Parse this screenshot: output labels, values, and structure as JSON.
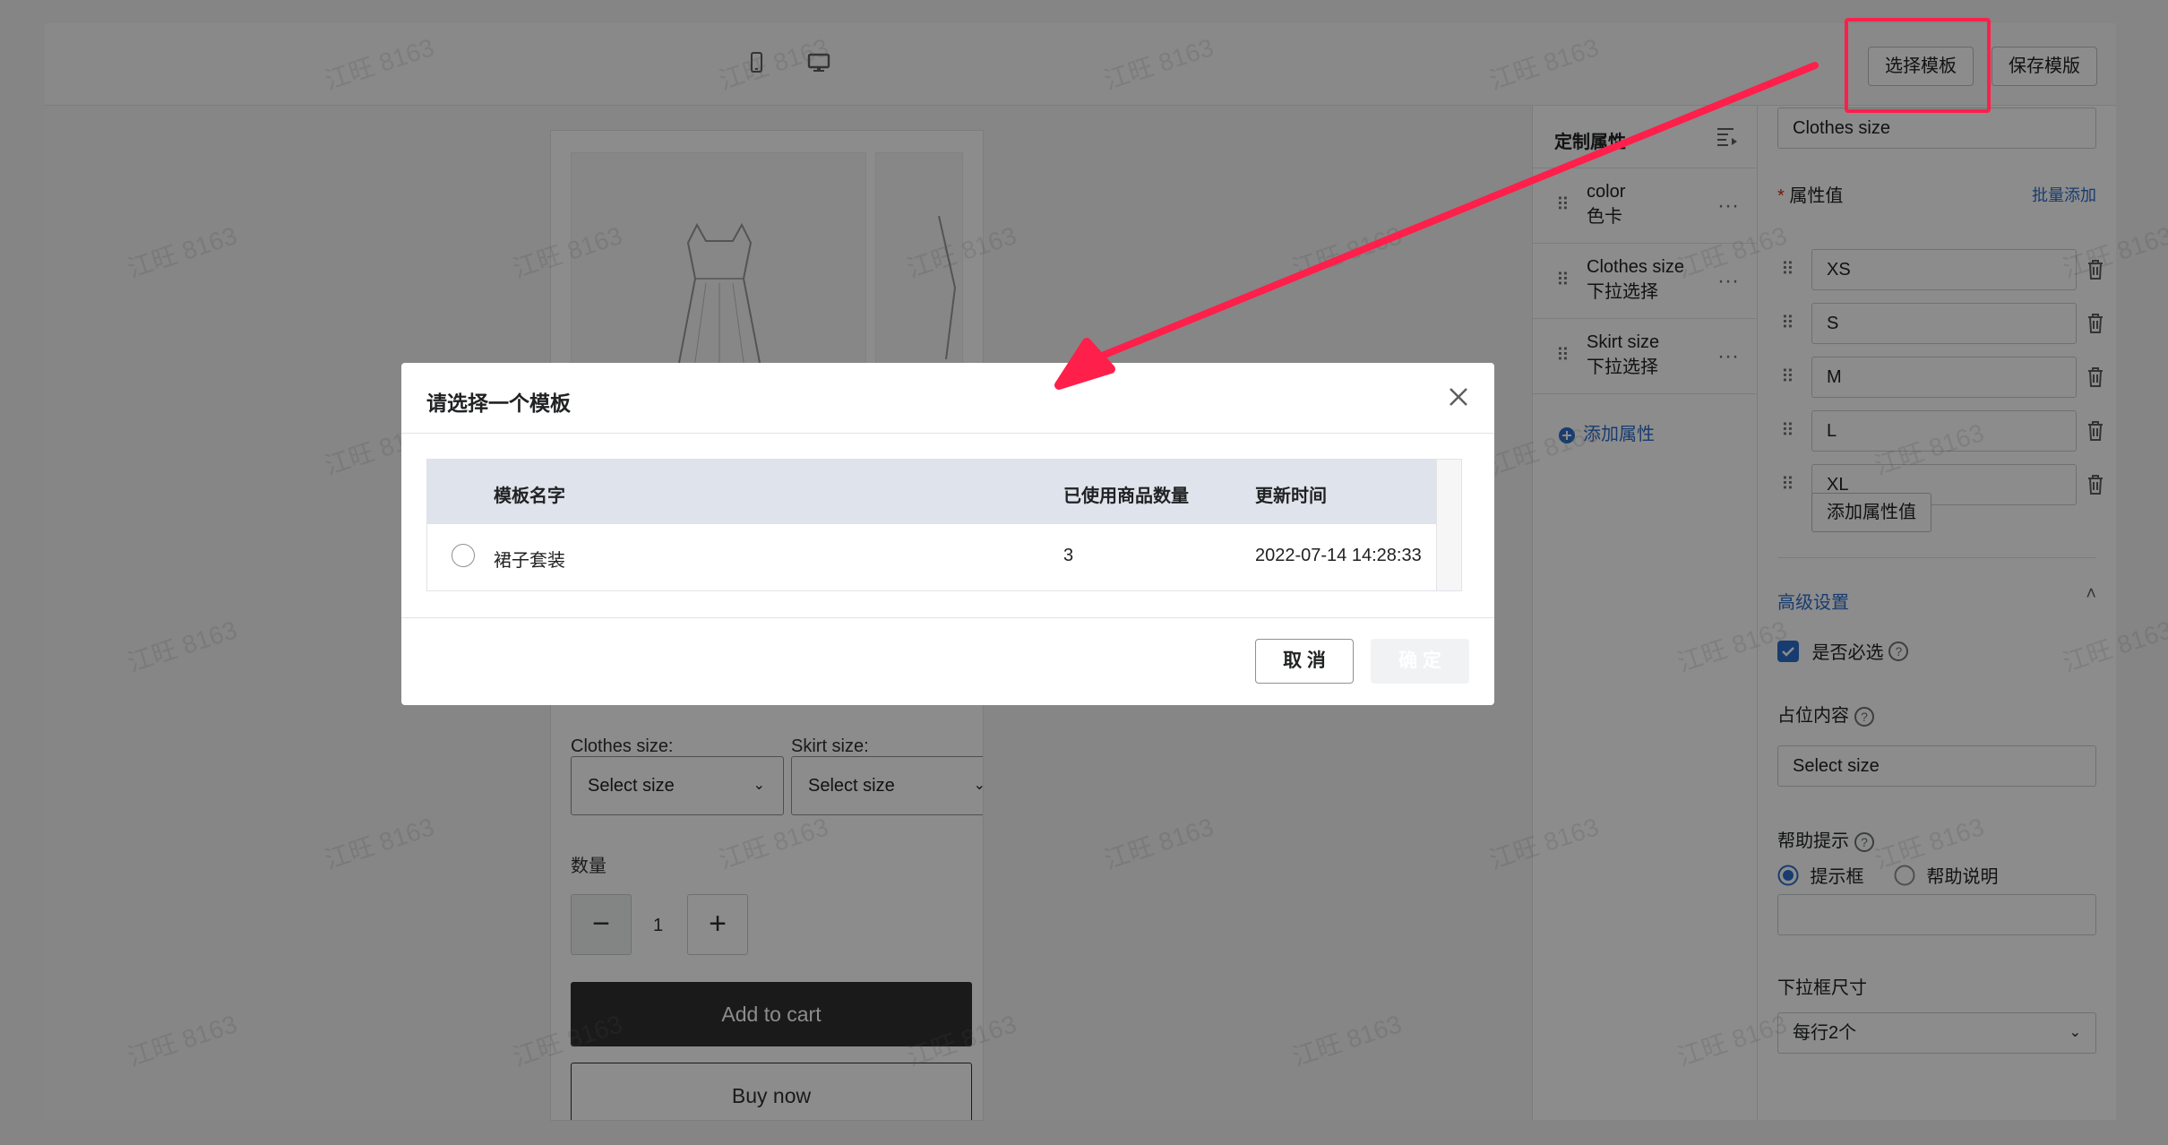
{
  "topbar": {
    "choose_template": "选择模板",
    "save_template": "保存模版"
  },
  "preview": {
    "clothes_size_label": "Clothes size:",
    "skirt_size_label": "Skirt size:",
    "select_placeholder": "Select size",
    "quantity_label": "数量",
    "quantity_value": "1",
    "add_to_cart": "Add to cart",
    "buy_now": "Buy now"
  },
  "attributes": {
    "header": "定制属性",
    "items": [
      {
        "name": "color",
        "type": "色卡"
      },
      {
        "name": "Clothes size",
        "type": "下拉选择"
      },
      {
        "name": "Skirt size",
        "type": "下拉选择"
      }
    ],
    "add_attribute": "添加属性"
  },
  "settings": {
    "attribute_name_value": "Clothes size",
    "values_label": "属性值",
    "bulk_add": "批量添加",
    "values": [
      "XS",
      "S",
      "M",
      "L",
      "XL"
    ],
    "add_value_button": "添加属性值",
    "advanced": "高级设置",
    "required_label": "是否必选",
    "required_checked": true,
    "placeholder_label": "占位内容",
    "placeholder_value": "Select size",
    "help_label": "帮助提示",
    "help_options": [
      "提示框",
      "帮助说明"
    ],
    "help_selected": "提示框",
    "dropdown_size_label": "下拉框尺寸",
    "dropdown_size_value": "每行2个"
  },
  "modal": {
    "title": "请选择一个模板",
    "columns": [
      "模板名字",
      "已使用商品数量",
      "更新时间"
    ],
    "rows": [
      {
        "name": "裙子套装",
        "count": "3",
        "updated": "2022-07-14 14:28:33"
      }
    ],
    "cancel": "取 消",
    "confirm": "确 定"
  },
  "watermark": "江旺 8163",
  "colors": {
    "annotation_red": "#ff1f4b",
    "primary_dark": "#303030",
    "link_blue": "#2c6ecb"
  }
}
